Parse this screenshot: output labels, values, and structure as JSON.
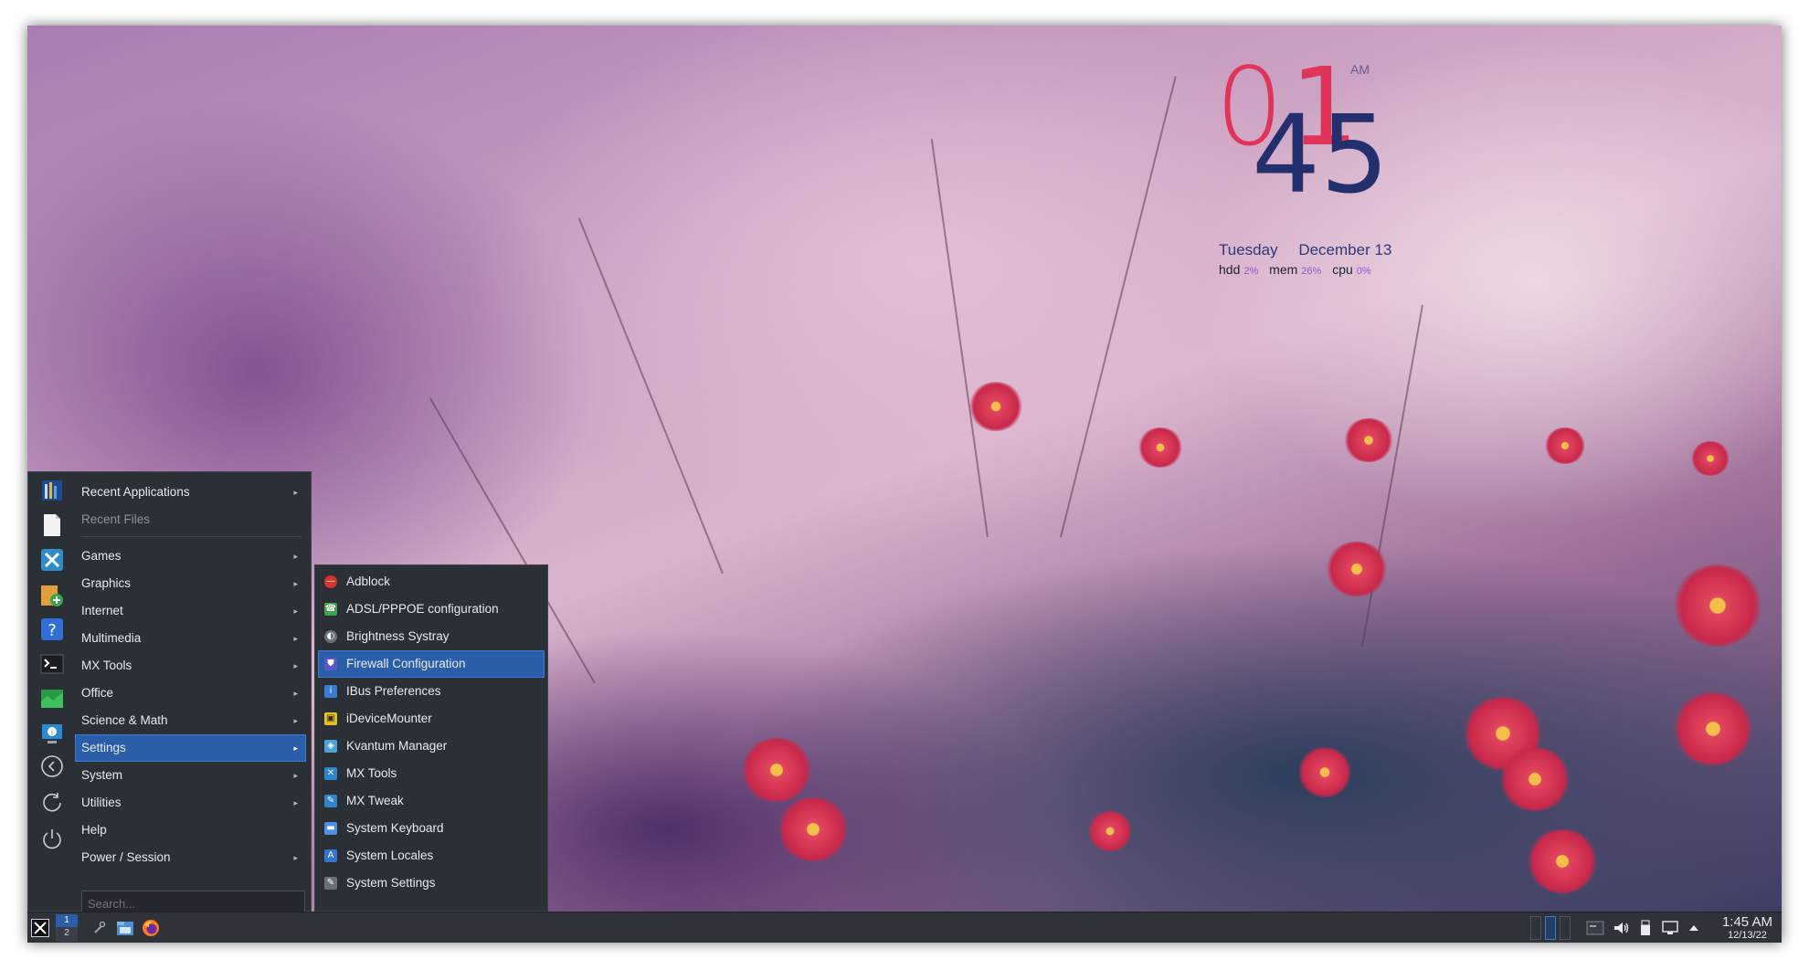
{
  "clock_widget": {
    "hour_first_digit": "0",
    "hour_second_digit": "1",
    "minutes": "45",
    "ampm": "AM",
    "weekday": "Tuesday",
    "date": "December 13",
    "hdd_label": "hdd",
    "hdd_value": "2%",
    "mem_label": "mem",
    "mem_value": "26%",
    "cpu_label": "cpu",
    "cpu_value": "0%"
  },
  "menu": {
    "items": [
      {
        "label": "Recent Applications",
        "arrow": "▸"
      },
      {
        "label": "Recent Files"
      },
      {
        "label": "Games",
        "arrow": "▸"
      },
      {
        "label": "Graphics",
        "arrow": "▸"
      },
      {
        "label": "Internet",
        "arrow": "▸"
      },
      {
        "label": "Multimedia",
        "arrow": "▸"
      },
      {
        "label": "MX Tools",
        "arrow": "▸"
      },
      {
        "label": "Office",
        "arrow": "▸"
      },
      {
        "label": "Science & Math",
        "arrow": "▸"
      },
      {
        "label": "Settings",
        "arrow": "▸"
      },
      {
        "label": "System",
        "arrow": "▸"
      },
      {
        "label": "Utilities",
        "arrow": "▸"
      },
      {
        "label": "Help"
      },
      {
        "label": "Power / Session",
        "arrow": "▸"
      }
    ],
    "search_placeholder": "Search..."
  },
  "submenu": {
    "items": [
      {
        "label": "Adblock",
        "icon": "adblock-icon",
        "color": "#d9342b",
        "glyph": "—"
      },
      {
        "label": "ADSL/PPPOE configuration",
        "icon": "network-icon",
        "color": "#3aa54a",
        "glyph": "☎"
      },
      {
        "label": "Brightness Systray",
        "icon": "brightness-icon",
        "color": "#6b7078",
        "glyph": "◐"
      },
      {
        "label": "Firewall Configuration",
        "icon": "shield-icon",
        "color": "#5b57c7",
        "glyph": "⛊"
      },
      {
        "label": "IBus Preferences",
        "icon": "ibus-icon",
        "color": "#3a7bd5",
        "glyph": "i"
      },
      {
        "label": "iDeviceMounter",
        "icon": "idevice-icon",
        "color": "#e4c21d",
        "glyph": "▣"
      },
      {
        "label": "Kvantum Manager",
        "icon": "kvantum-icon",
        "color": "#4aa3d8",
        "glyph": "◈"
      },
      {
        "label": "MX Tools",
        "icon": "mx-tools-icon",
        "color": "#2d86c9",
        "glyph": "✕"
      },
      {
        "label": "MX Tweak",
        "icon": "mx-tweak-icon",
        "color": "#2d86c9",
        "glyph": "✎"
      },
      {
        "label": "System Keyboard",
        "icon": "keyboard-icon",
        "color": "#4d8fe0",
        "glyph": "▬"
      },
      {
        "label": "System Locales",
        "icon": "locales-icon",
        "color": "#3474d4",
        "glyph": "A"
      },
      {
        "label": "System Settings",
        "icon": "settings-icon",
        "color": "#6b7078",
        "glyph": "✎"
      }
    ]
  },
  "taskbar": {
    "pager_top": "1",
    "pager_bottom": "2",
    "time": "1:45 AM",
    "date": "12/13/22"
  }
}
